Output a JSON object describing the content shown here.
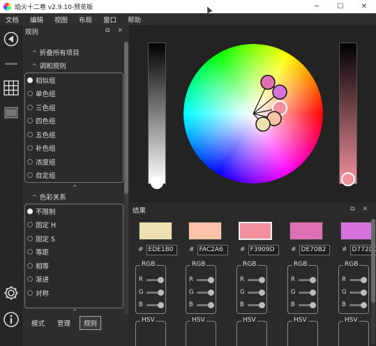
{
  "window": {
    "title": "焰火十二卷 v2.9.10-预览版",
    "controls": {
      "minimize": "─",
      "maximize": "☐",
      "close": "✕"
    }
  },
  "menu": [
    "文档",
    "编辑",
    "视图",
    "布局",
    "窗口",
    "帮助"
  ],
  "toolstrip": {
    "icons": [
      "wheel-tool-icon",
      "grid-icon",
      "screenshot-icon",
      "settings-icon",
      "info-icon"
    ]
  },
  "rules_panel": {
    "title": "规则",
    "header_buttons": "⧉ ✕",
    "collapse_all": "折叠所有项目",
    "harmony_section": "调和规则",
    "harmony_rules": [
      "相似组",
      "单色组",
      "三色组",
      "四色组",
      "五色组",
      "补色组",
      "浓度组",
      "自定组"
    ],
    "harmony_selected": 0,
    "relation_section": "色彩关系",
    "relations": [
      "不限制",
      "固定 H",
      "固定 S",
      "等距",
      "相等",
      "渐进",
      "对称"
    ],
    "relation_selected": 0,
    "tabs": [
      "模式",
      "管理",
      "规则"
    ],
    "active_tab": 2
  },
  "results_panel": {
    "title": "结果",
    "header_buttons": "⧉ ✕",
    "hash": "#",
    "colors": [
      {
        "hex": "EDE1B0",
        "swatch": "#EDE1B0"
      },
      {
        "hex": "FAC2A6",
        "swatch": "#FAC2A6"
      },
      {
        "hex": "F3909D",
        "swatch": "#F3909D"
      },
      {
        "hex": "DE70B2",
        "swatch": "#DE70B2"
      },
      {
        "hex": "D772DD",
        "swatch": "#D772DD"
      }
    ],
    "selected_index": 2,
    "rgb_title": "RGB",
    "channels": [
      "R",
      "G",
      "B"
    ],
    "hsv_title": "HSV"
  },
  "wheel_colors": {
    "accent_handle": "#F3909D",
    "swatch_border": "#f0f0f0"
  }
}
